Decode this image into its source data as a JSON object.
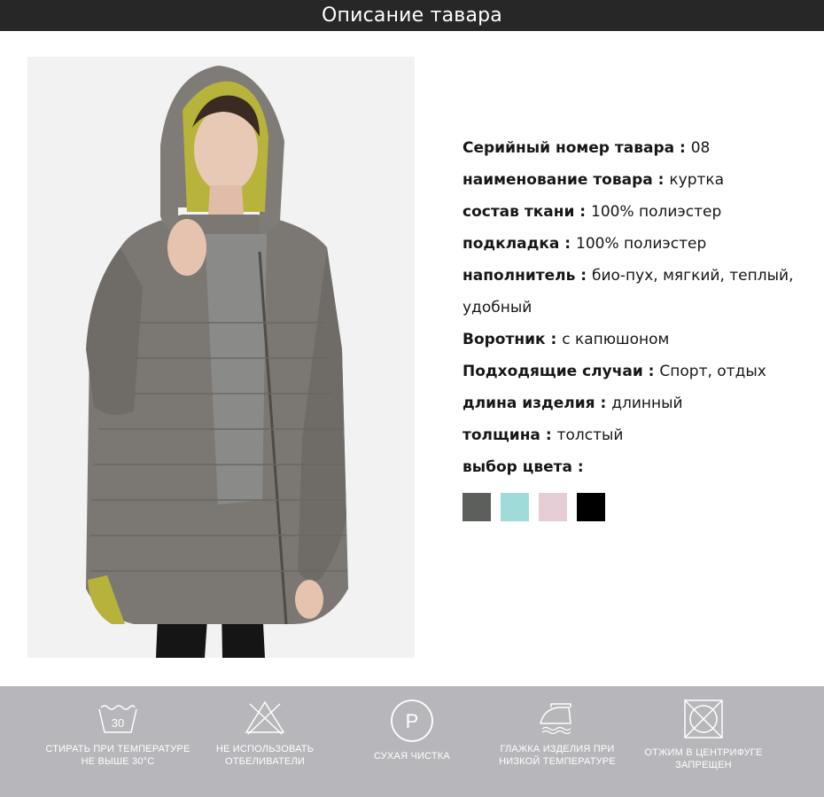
{
  "header": {
    "title": "Описание тавара"
  },
  "specs": [
    {
      "key": "Серийный номер тавара",
      "sep": " : ",
      "value": "08"
    },
    {
      "key": "наименование товара",
      "sep": " : ",
      "value": "куртка"
    },
    {
      "key": "состав ткани",
      "sep": " : ",
      "value": "100% полиэстер"
    },
    {
      "key": "подкладка",
      "sep": " : ",
      "value": "100% полиэстер"
    },
    {
      "key": "наполнитель",
      "sep": " : ",
      "value": "био-пух, мягкий, теплый, удобный"
    },
    {
      "key": "Воротник",
      "sep": " : ",
      "value": "с капюшоном"
    },
    {
      "key": "Подходящие случаи",
      "sep": " : ",
      "value": "Спорт, отдых"
    },
    {
      "key": "длина изделия",
      "sep": " : ",
      "value": "длинный"
    },
    {
      "key": "толщина",
      "sep": " : ",
      "value": "толстый"
    },
    {
      "key": "выбор цвета",
      "sep": " :",
      "value": ""
    }
  ],
  "colors": [
    "#5d5f5c",
    "#9fdcd9",
    "#e5cdd6",
    "#000000"
  ],
  "care": {
    "wash_temp": "30",
    "items": [
      {
        "icon": "wash-30-icon",
        "line1": "СТИРАТЬ ПРИ ТЕМПЕРАТУРЕ",
        "line2": "НЕ ВЫШЕ 30°C"
      },
      {
        "icon": "no-bleach-icon",
        "line1": "НЕ ИСПОЛЬЗОВАТЬ",
        "line2": "ОТБЕЛИВАТЕЛИ"
      },
      {
        "icon": "dry-clean-p-icon",
        "line1": "СУХАЯ ЧИСТКА",
        "line2": ""
      },
      {
        "icon": "iron-low-icon",
        "line1": "ГЛАЖКА ИЗДЕЛИЯ ПРИ",
        "line2": "НИЗКОЙ ТЕМПЕРАТУРЕ"
      },
      {
        "icon": "no-tumble-dry-icon",
        "line1": "ОТЖИМ В ЦЕНТРИФУГЕ",
        "line2": "ЗАПРЕЩЕН"
      }
    ]
  }
}
